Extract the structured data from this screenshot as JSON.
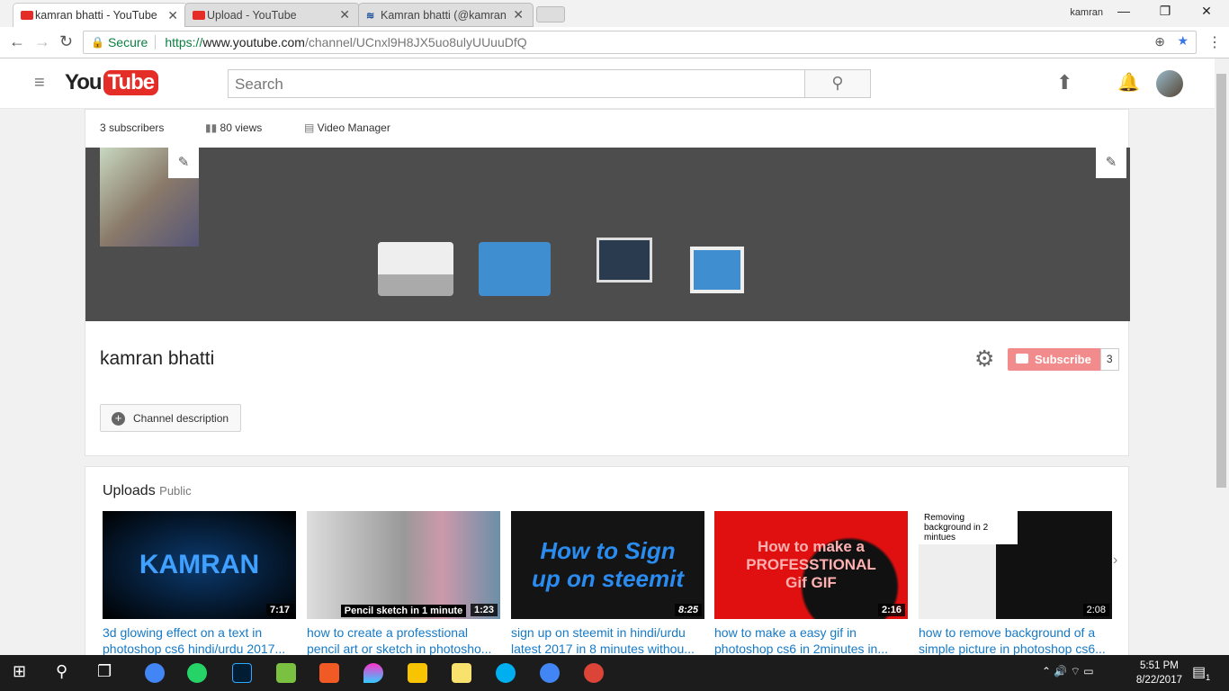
{
  "browser": {
    "tabs": [
      {
        "title": "kamran bhatti - YouTube",
        "active": true
      },
      {
        "title": "Upload - YouTube",
        "active": false
      },
      {
        "title": "Kamran bhatti (@kamran",
        "active": false
      }
    ],
    "profile_name": "kamran",
    "secure_label": "Secure",
    "url_scheme": "https://",
    "url_host": "www.youtube.com",
    "url_path": "/channel/UCnxl9H8JX5uo8ulyUUuuDfQ"
  },
  "youtube": {
    "logo_you": "You",
    "logo_tube": "Tube",
    "search_placeholder": "Search"
  },
  "channel": {
    "subscribers": "3 subscribers",
    "views": "80 views",
    "video_manager": "Video Manager",
    "name": "kamran bhatti",
    "subscribe_label": "Subscribe",
    "subscribe_count": "3",
    "description_button": "Channel description"
  },
  "uploads": {
    "title": "Uploads",
    "visibility": "Public",
    "videos": [
      {
        "thumb_text": "KAMRAN",
        "duration": "7:17",
        "title1": "3d glowing effect on a text in",
        "title2": "photoshop cs6 hindi/urdu 2017..."
      },
      {
        "thumb_text": "Pencil sketch in 1 minute",
        "duration": "1:23",
        "title1": "how to create a professtional",
        "title2": "pencil art or sketch in photosho..."
      },
      {
        "thumb_text": "How to Sign up on steemit",
        "duration": "8:25",
        "title1": "sign up on steemit in hindi/urdu",
        "title2": "latest 2017 in 8 minutes withou..."
      },
      {
        "thumb_text": "How to make a PROFESSTIONAL Gif GIF",
        "duration": "2:16",
        "title1": "how to make a easy gif in",
        "title2": "photoshop cs6 in 2minutes in..."
      },
      {
        "thumb_text": "Removing background in 2 mintues",
        "duration": "2:08",
        "title1": "how to remove background of a",
        "title2": "simple picture in photoshop cs6..."
      }
    ]
  },
  "taskbar": {
    "time": "5:51 PM",
    "date": "8/22/2017",
    "notifications": "1"
  },
  "colors": {
    "accent": "#e52d27",
    "link": "#167ac6",
    "subscribe": "#f28c8c"
  }
}
